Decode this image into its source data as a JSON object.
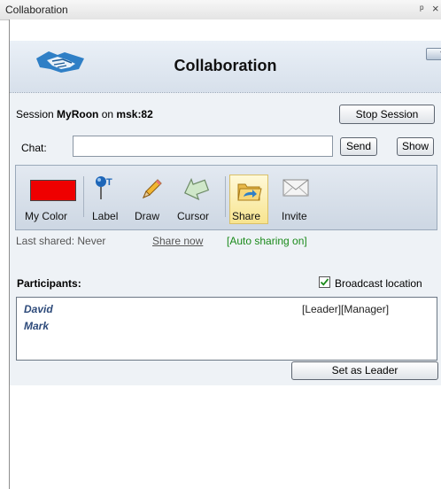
{
  "window": {
    "title": "Collaboration",
    "pin_glyph": "т",
    "close_glyph": "×"
  },
  "header": {
    "title": "Collaboration",
    "help_label": "?",
    "logo_icon": "handshake-icon"
  },
  "session": {
    "prefix": "Session",
    "name": "MyRoon",
    "on": "on",
    "host": "msk:82",
    "stop_button": "Stop Session"
  },
  "chat": {
    "label": "Chat:",
    "value": "",
    "send_button": "Send",
    "show_button": "Show"
  },
  "toolbar": {
    "items": [
      {
        "label": "My Color",
        "icon": "color-swatch",
        "color": "#ef0000"
      },
      {
        "label": "Label",
        "icon": "label-pin-icon"
      },
      {
        "label": "Draw",
        "icon": "pencil-icon"
      },
      {
        "label": "Cursor",
        "icon": "cursor-arrow-icon"
      },
      {
        "label": "Share",
        "icon": "folder-share-icon",
        "active": true
      },
      {
        "label": "Invite",
        "icon": "envelope-icon"
      }
    ]
  },
  "sharing": {
    "last_shared": "Last shared: Never",
    "share_now": "Share now",
    "auto_sharing": "[Auto sharing on]"
  },
  "participants": {
    "label": "Participants:",
    "broadcast_label": "Broadcast location",
    "broadcast_checked": true,
    "list": [
      {
        "name": "David",
        "roles": "[Leader][Manager]"
      },
      {
        "name": "Mark",
        "roles": ""
      }
    ],
    "set_leader_button": "Set as Leader"
  }
}
